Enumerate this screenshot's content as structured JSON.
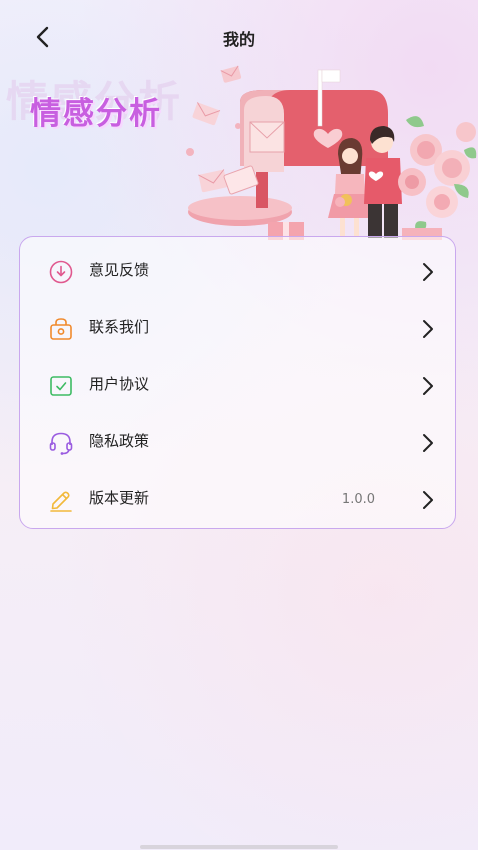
{
  "header": {
    "title": "我的"
  },
  "banner": {
    "title": "情感分析",
    "ghost_title": "情感分析"
  },
  "menu": {
    "items": [
      {
        "label": "意见反馈",
        "icon": "feedback-download-icon",
        "value": ""
      },
      {
        "label": "联系我们",
        "icon": "contact-bag-icon",
        "value": ""
      },
      {
        "label": "用户协议",
        "icon": "agreement-check-icon",
        "value": ""
      },
      {
        "label": "隐私政策",
        "icon": "headset-privacy-icon",
        "value": ""
      },
      {
        "label": "版本更新",
        "icon": "pencil-update-icon",
        "value": "1.0.0"
      }
    ]
  },
  "colors": {
    "accent": "#c85fe0",
    "card_border": "#c9a8ee",
    "feedback_icon": "#e0588e",
    "contact_icon": "#f08a2c",
    "agreement_icon": "#3dbb63",
    "privacy_icon": "#9a5ce0",
    "update_icon": "#f2b93a"
  }
}
